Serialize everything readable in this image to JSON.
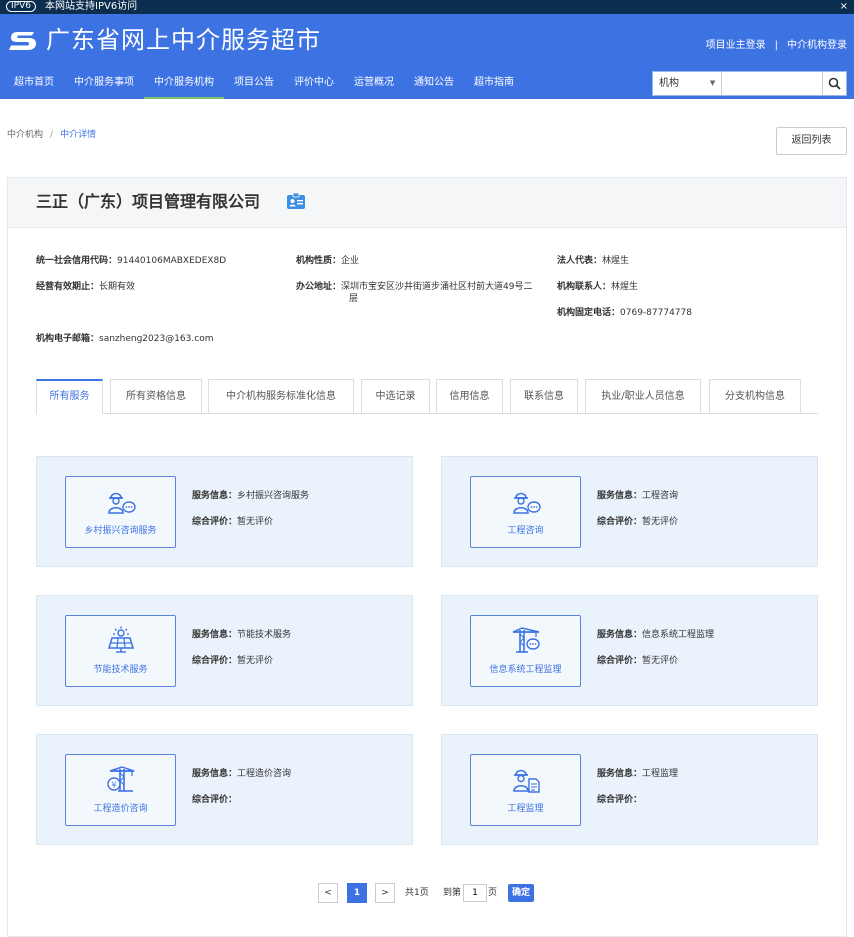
{
  "topbar": {
    "ipv6_badge": "IPV6",
    "ipv6_text": "本网站支持IPV6访问",
    "close": "×"
  },
  "header": {
    "site_title": "广东省网上中介服务超市",
    "owner_login": "项目业主登录",
    "sep": "|",
    "agency_login": "中介机构登录"
  },
  "nav": [
    "超市首页",
    "中介服务事项",
    "中介服务机构",
    "项目公告",
    "评价中心",
    "运营概况",
    "通知公告",
    "超市指南"
  ],
  "search": {
    "select_value": "机构",
    "placeholder": ""
  },
  "breadcrumb": {
    "root": "中介机构",
    "sep": "/",
    "current": "中介详情"
  },
  "back_button": "返回列表",
  "company": {
    "name": "三正（广东）项目管理有限公司",
    "credit_code_label": "统一社会信用代码：",
    "credit_code": "91440106MABXEDEX8D",
    "nature_label": "机构性质：",
    "nature": "企业",
    "legal_label": "法人代表：",
    "legal": "林煋生",
    "valid_label": "经营有效期止：",
    "valid": "长期有效",
    "address_label": "办公地址：",
    "address_line1": "深圳市宝安区沙井街道步涌社区村前大道49号二",
    "address_line2": "层",
    "contact_label": "机构联系人：",
    "contact": "林煋生",
    "phone_label": "机构固定电话：",
    "phone": "0769-87774778",
    "email_label": "机构电子邮箱：",
    "email": "sanzheng2023@163.com"
  },
  "tabs": [
    "所有服务",
    "所有资格信息",
    "中介机构服务标准化信息",
    "中选记录",
    "信用信息",
    "联系信息",
    "执业/职业人员信息",
    "分支机构信息"
  ],
  "services": [
    {
      "name": "乡村振兴咨询服务",
      "info_label": "服务信息：",
      "info": "乡村振兴咨询服务",
      "rating_label": "综合评价：",
      "rating": "暂无评价",
      "icon": "worker-chat-icon"
    },
    {
      "name": "工程咨询",
      "info_label": "服务信息：",
      "info": "工程咨询",
      "rating_label": "综合评价：",
      "rating": "暂无评价",
      "icon": "worker-chat-icon"
    },
    {
      "name": "节能技术服务",
      "info_label": "服务信息：",
      "info": "节能技术服务",
      "rating_label": "综合评价：",
      "rating": "暂无评价",
      "icon": "solar-panel-icon"
    },
    {
      "name": "信息系统工程监理",
      "info_label": "服务信息：",
      "info": "信息系统工程监理",
      "rating_label": "综合评价：",
      "rating": "暂无评价",
      "icon": "crane-chat-icon"
    },
    {
      "name": "工程造价咨询",
      "info_label": "服务信息：",
      "info": "工程造价咨询",
      "rating_label": "综合评价：",
      "rating": "",
      "icon": "crane-yuan-icon"
    },
    {
      "name": "工程监理",
      "info_label": "服务信息：",
      "info": "工程监理",
      "rating_label": "综合评价：",
      "rating": "",
      "icon": "worker-document-icon"
    }
  ],
  "pager": {
    "prev": "<",
    "current": "1",
    "next": ">",
    "total": "共1页",
    "goto": "到第",
    "page_value": "1",
    "page_unit": "页",
    "confirm": "确定"
  },
  "colors": {
    "brand": "#3d72e3",
    "topbar": "#0b2e4e",
    "card_bg": "#eaf2fb",
    "nav_active": "#7ec36a"
  }
}
